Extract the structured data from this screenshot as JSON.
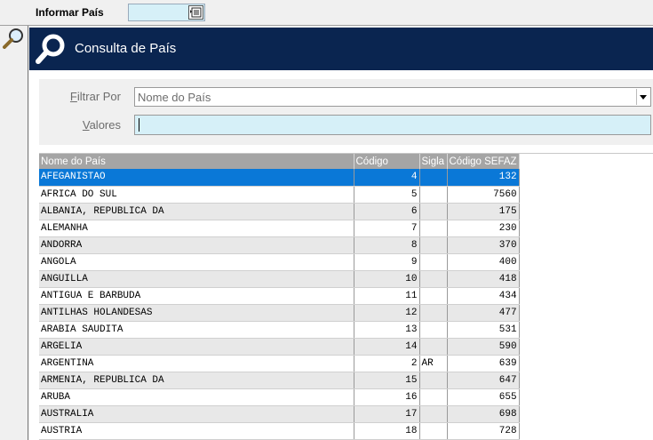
{
  "topbar": {
    "label": "Informar País",
    "field_value": ""
  },
  "panel": {
    "title": "Consulta de País"
  },
  "filters": {
    "filter_label_prefix": "F",
    "filter_label_rest": "iltrar Por",
    "filter_value": "Nome do País",
    "values_label_prefix": "V",
    "values_label_rest": "alores",
    "values_input": ""
  },
  "table": {
    "columns": [
      "Nome do País",
      "Código",
      "Sigla",
      "Código SEFAZ"
    ],
    "rows": [
      {
        "name": "AFEGANISTAO",
        "code": "4",
        "sigla": "",
        "sefaz": "132"
      },
      {
        "name": "AFRICA DO SUL",
        "code": "5",
        "sigla": "",
        "sefaz": "7560"
      },
      {
        "name": "ALBANIA, REPUBLICA DA",
        "code": "6",
        "sigla": "",
        "sefaz": "175"
      },
      {
        "name": "ALEMANHA",
        "code": "7",
        "sigla": "",
        "sefaz": "230"
      },
      {
        "name": "ANDORRA",
        "code": "8",
        "sigla": "",
        "sefaz": "370"
      },
      {
        "name": "ANGOLA",
        "code": "9",
        "sigla": "",
        "sefaz": "400"
      },
      {
        "name": "ANGUILLA",
        "code": "10",
        "sigla": "",
        "sefaz": "418"
      },
      {
        "name": "ANTIGUA E BARBUDA",
        "code": "11",
        "sigla": "",
        "sefaz": "434"
      },
      {
        "name": "ANTILHAS HOLANDESAS",
        "code": "12",
        "sigla": "",
        "sefaz": "477"
      },
      {
        "name": "ARABIA SAUDITA",
        "code": "13",
        "sigla": "",
        "sefaz": "531"
      },
      {
        "name": "ARGELIA",
        "code": "14",
        "sigla": "",
        "sefaz": "590"
      },
      {
        "name": "ARGENTINA",
        "code": "2",
        "sigla": "AR",
        "sefaz": "639"
      },
      {
        "name": "ARMENIA, REPUBLICA DA",
        "code": "15",
        "sigla": "",
        "sefaz": "647"
      },
      {
        "name": "ARUBA",
        "code": "16",
        "sigla": "",
        "sefaz": "655"
      },
      {
        "name": "AUSTRALIA",
        "code": "17",
        "sigla": "",
        "sefaz": "698"
      },
      {
        "name": "AUSTRIA",
        "code": "18",
        "sigla": "",
        "sefaz": "728"
      }
    ],
    "selected_row": "AFEGANISTAO"
  },
  "colors": {
    "header_bg": "#0a2550",
    "selection": "#0a78d7",
    "input_bg": "#d6f0f8"
  },
  "icons": [
    "lookup-list-icon",
    "zoom-search-icon",
    "magnifier-icon",
    "dropdown-arrow-icon"
  ]
}
